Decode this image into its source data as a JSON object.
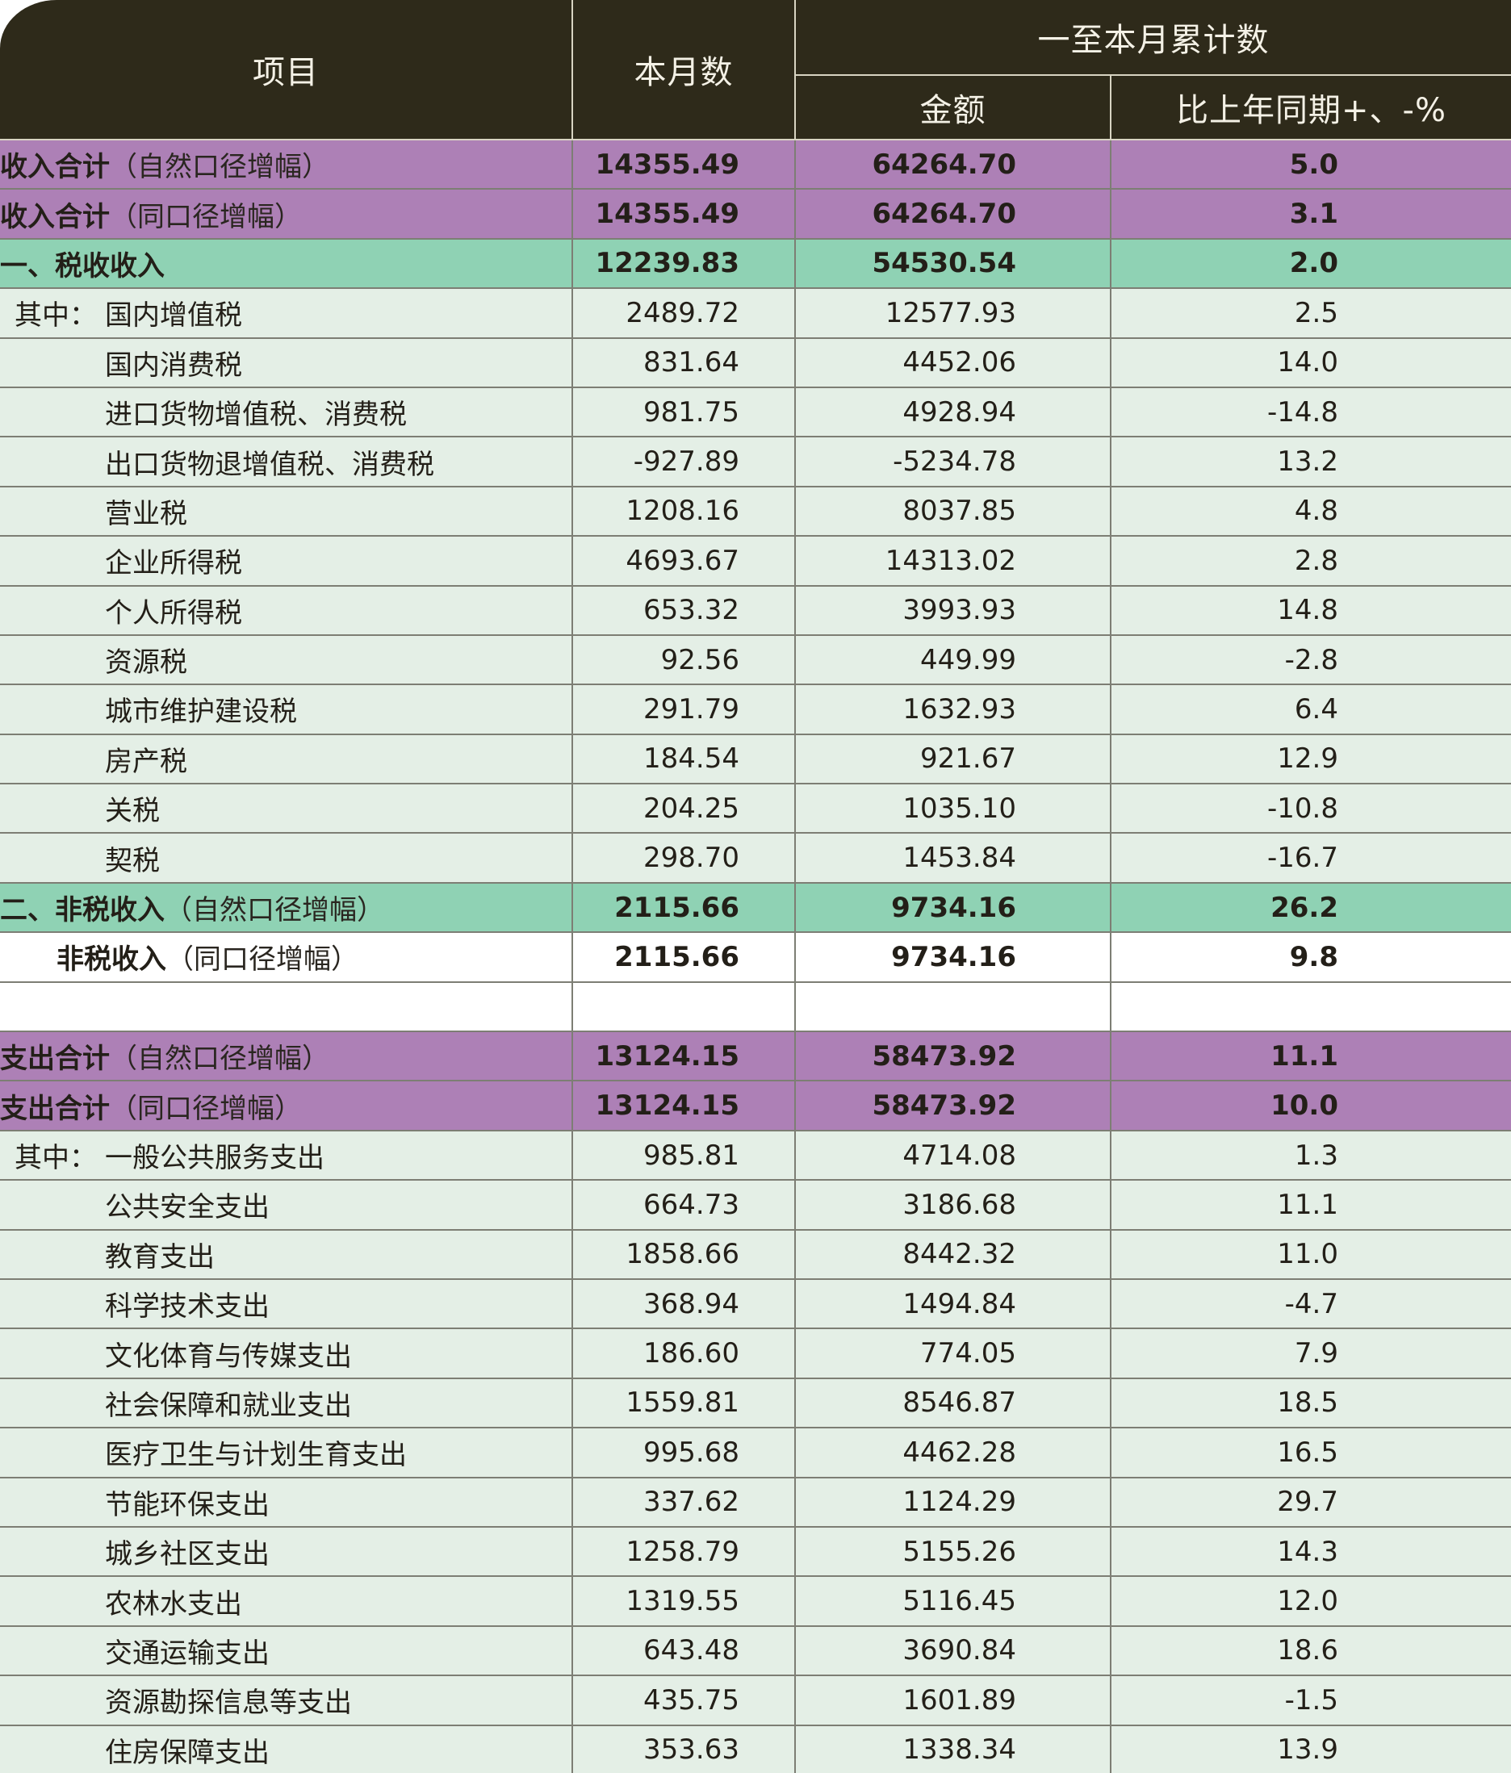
{
  "header": {
    "col_item": "项目",
    "col_month": "本月数",
    "col_cumulative": "一至本月累计数",
    "col_amount": "金额",
    "col_yoy": "比上年同期+、-%"
  },
  "rows": [
    {
      "name": "收入合计",
      "note": "（自然口径增幅）",
      "month": "14355.49",
      "amount": "64264.70",
      "yoy": "5.0"
    },
    {
      "name": "收入合计",
      "note": "（同口径增幅）",
      "month": "14355.49",
      "amount": "64264.70",
      "yoy": "3.1"
    },
    {
      "name": "一、税收收入",
      "month": "12239.83",
      "amount": "54530.54",
      "yoy": "2.0"
    },
    {
      "prefix": "其中：",
      "name": "国内增值税",
      "month": "2489.72",
      "amount": "12577.93",
      "yoy": "2.5"
    },
    {
      "name": "国内消费税",
      "month": "831.64",
      "amount": "4452.06",
      "yoy": "14.0"
    },
    {
      "name": "进口货物增值税、消费税",
      "month": "981.75",
      "amount": "4928.94",
      "yoy": "-14.8"
    },
    {
      "name": "出口货物退增值税、消费税",
      "month": "-927.89",
      "amount": "-5234.78",
      "yoy": "13.2"
    },
    {
      "name": "营业税",
      "month": "1208.16",
      "amount": "8037.85",
      "yoy": "4.8"
    },
    {
      "name": "企业所得税",
      "month": "4693.67",
      "amount": "14313.02",
      "yoy": "2.8"
    },
    {
      "name": "个人所得税",
      "month": "653.32",
      "amount": "3993.93",
      "yoy": "14.8"
    },
    {
      "name": "资源税",
      "month": "92.56",
      "amount": "449.99",
      "yoy": "-2.8"
    },
    {
      "name": "城市维护建设税",
      "month": "291.79",
      "amount": "1632.93",
      "yoy": "6.4"
    },
    {
      "name": "房产税",
      "month": "184.54",
      "amount": "921.67",
      "yoy": "12.9"
    },
    {
      "name": "关税",
      "month": "204.25",
      "amount": "1035.10",
      "yoy": "-10.8"
    },
    {
      "name": "契税",
      "month": "298.70",
      "amount": "1453.84",
      "yoy": "-16.7"
    },
    {
      "name": "二、非税收入",
      "note": "（自然口径增幅）",
      "month": "2115.66",
      "amount": "9734.16",
      "yoy": "26.2"
    },
    {
      "name": "非税收入",
      "note": "（同口径增幅）",
      "month": "2115.66",
      "amount": "9734.16",
      "yoy": "9.8"
    },
    {
      "name": "",
      "month": "",
      "amount": "",
      "yoy": ""
    },
    {
      "name": "支出合计",
      "note": "（自然口径增幅）",
      "month": "13124.15",
      "amount": "58473.92",
      "yoy": "11.1"
    },
    {
      "name": "支出合计",
      "note": "（同口径增幅）",
      "month": "13124.15",
      "amount": "58473.92",
      "yoy": "10.0"
    },
    {
      "prefix": "其中：",
      "name": "一般公共服务支出",
      "month": "985.81",
      "amount": "4714.08",
      "yoy": "1.3"
    },
    {
      "name": "公共安全支出",
      "month": "664.73",
      "amount": "3186.68",
      "yoy": "11.1"
    },
    {
      "name": "教育支出",
      "month": "1858.66",
      "amount": "8442.32",
      "yoy": "11.0"
    },
    {
      "name": "科学技术支出",
      "month": "368.94",
      "amount": "1494.84",
      "yoy": "-4.7"
    },
    {
      "name": "文化体育与传媒支出",
      "month": "186.60",
      "amount": "774.05",
      "yoy": "7.9"
    },
    {
      "name": "社会保障和就业支出",
      "month": "1559.81",
      "amount": "8546.87",
      "yoy": "18.5"
    },
    {
      "name": "医疗卫生与计划生育支出",
      "month": "995.68",
      "amount": "4462.28",
      "yoy": "16.5"
    },
    {
      "name": "节能环保支出",
      "month": "337.62",
      "amount": "1124.29",
      "yoy": "29.7"
    },
    {
      "name": "城乡社区支出",
      "month": "1258.79",
      "amount": "5155.26",
      "yoy": "14.3"
    },
    {
      "name": "农林水支出",
      "month": "1319.55",
      "amount": "5116.45",
      "yoy": "12.0"
    },
    {
      "name": "交通运输支出",
      "month": "643.48",
      "amount": "3690.84",
      "yoy": "18.6"
    },
    {
      "name": "资源勘探信息等支出",
      "month": "435.75",
      "amount": "1601.89",
      "yoy": "-1.5"
    },
    {
      "name": "住房保障支出",
      "month": "353.63",
      "amount": "1338.34",
      "yoy": "13.9"
    }
  ],
  "colors": {
    "header_bg": "#2e2a1a",
    "purple_row": "#ad80b6",
    "teal_row": "#8fd2b4",
    "light_row": "#e4efe6"
  }
}
